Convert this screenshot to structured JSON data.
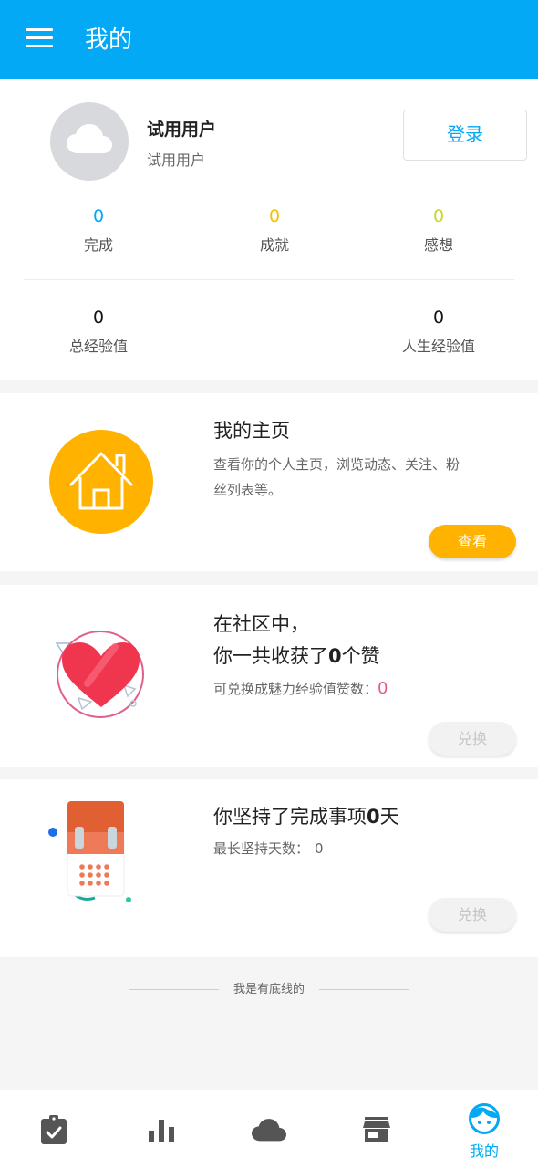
{
  "header": {
    "title": "我的"
  },
  "profile": {
    "name": "试用用户",
    "subtitle": "试用用户",
    "login_label": "登录",
    "stats_row1": [
      {
        "value": "0",
        "label": "完成",
        "color": "#03a9f4"
      },
      {
        "value": "0",
        "label": "成就",
        "color": "#f2c200"
      },
      {
        "value": "0",
        "label": "感想",
        "color": "#c8d630"
      }
    ],
    "stats_row2": [
      {
        "value": "0",
        "label": "总经验值"
      },
      {
        "value": "0",
        "label": "人生经验值"
      }
    ]
  },
  "homepage_card": {
    "title": "我的主页",
    "desc_line1": "查看你的个人主页，浏览动态、关注、粉",
    "desc_line2": "丝列表等。",
    "button": "查看"
  },
  "likes_card": {
    "title_line1": "在社区中，",
    "title_prefix": "你一共收获了",
    "count": "0",
    "title_suffix": "个赞",
    "desc_prefix": "可兑换成魅力经验值赞数：",
    "exchangeable": "0",
    "button": "兑换"
  },
  "streak_card": {
    "title_prefix": "你坚持了完成事项",
    "days": "0",
    "title_suffix": "天",
    "desc_prefix": "最长坚持天数：",
    "longest": "0",
    "button": "兑换"
  },
  "footer": {
    "note": "我是有底线的"
  },
  "bottom_nav": {
    "items": [
      {
        "icon": "clipboard-check-icon"
      },
      {
        "icon": "bar-chart-icon"
      },
      {
        "icon": "cloud-icon"
      },
      {
        "icon": "store-icon"
      },
      {
        "icon": "face-icon",
        "label": "我的",
        "active": true
      }
    ]
  },
  "colors": {
    "primary": "#03a9f4",
    "accent_yellow": "#ffb300",
    "pink": "#e95a7e"
  }
}
